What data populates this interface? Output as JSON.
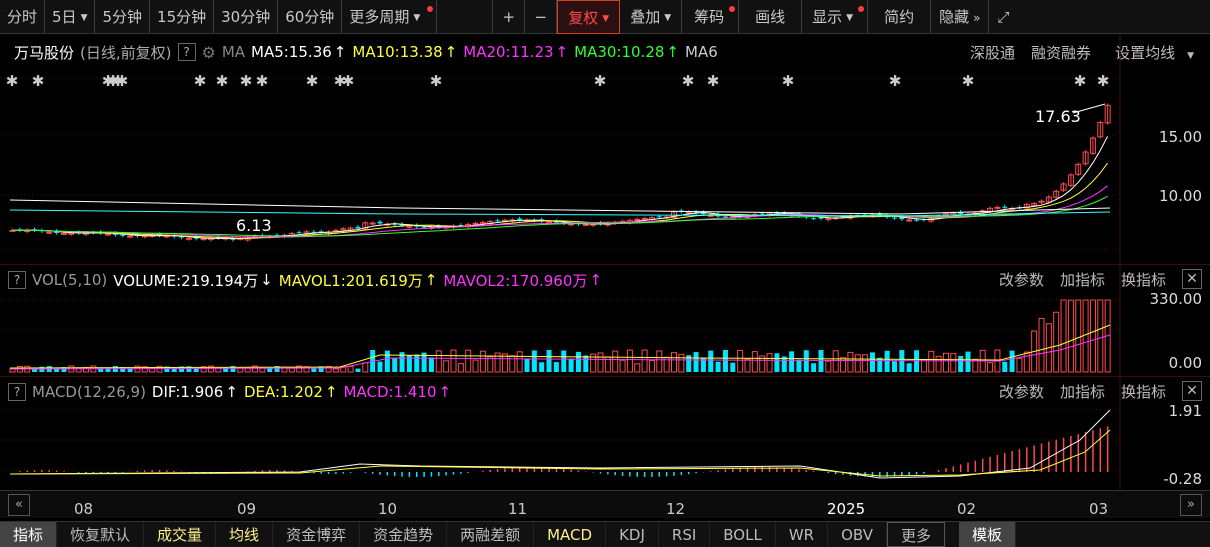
{
  "toolbar": {
    "periods": [
      "分时",
      "5日",
      "5分钟",
      "15分钟",
      "30分钟",
      "60分钟",
      "更多周期"
    ],
    "plus": "+",
    "minus": "−",
    "adjust": "复权",
    "overlay": "叠加",
    "chips": "筹码",
    "draw": "画线",
    "display": "显示",
    "simple": "简约",
    "hide": "隐藏"
  },
  "main": {
    "stock_name": "万马股份",
    "mode": "(日线,前复权)",
    "help": "?",
    "ma_label": "MA",
    "ma5": "MA5:15.36",
    "ma10": "MA10:13.38",
    "ma20": "MA20:11.23",
    "ma30": "MA30:10.28",
    "ma_more": "MA6",
    "links": [
      "深股通",
      "融资融券",
      "设置均线"
    ],
    "y_labels": [
      "15.00",
      "10.00"
    ],
    "high_label": "17.63",
    "low_label": "6.13"
  },
  "volume": {
    "title": "VOL(5,10)",
    "volume": "VOLUME:219.194万",
    "mavol1": "MAVOL1:201.619万",
    "mavol2": "MAVOL2:170.960万",
    "y_labels": [
      "330.00",
      "0.00"
    ],
    "links": [
      "改参数",
      "加指标",
      "换指标"
    ]
  },
  "macd": {
    "title": "MACD(12,26,9)",
    "dif": "DIF:1.906",
    "dea": "DEA:1.202",
    "macd": "MACD:1.410",
    "y_labels": [
      "1.91",
      "-0.28"
    ],
    "links": [
      "改参数",
      "加指标",
      "换指标"
    ]
  },
  "xaxis": [
    "08",
    "09",
    "10",
    "11",
    "12",
    "2025",
    "02",
    "03"
  ],
  "bottom_tabs": [
    "指标",
    "恢复默认",
    "成交量",
    "均线",
    "资金博弈",
    "资金趋势",
    "两融差额",
    "MACD",
    "KDJ",
    "RSI",
    "BOLL",
    "WR",
    "OBV",
    "更多",
    "模板"
  ],
  "colors": {
    "up": "#ff4a4a",
    "down": "#00e5ff",
    "ma5": "#ffffff",
    "ma10": "#ffff3a",
    "ma20": "#ff33ff",
    "ma30": "#33ff33"
  }
}
